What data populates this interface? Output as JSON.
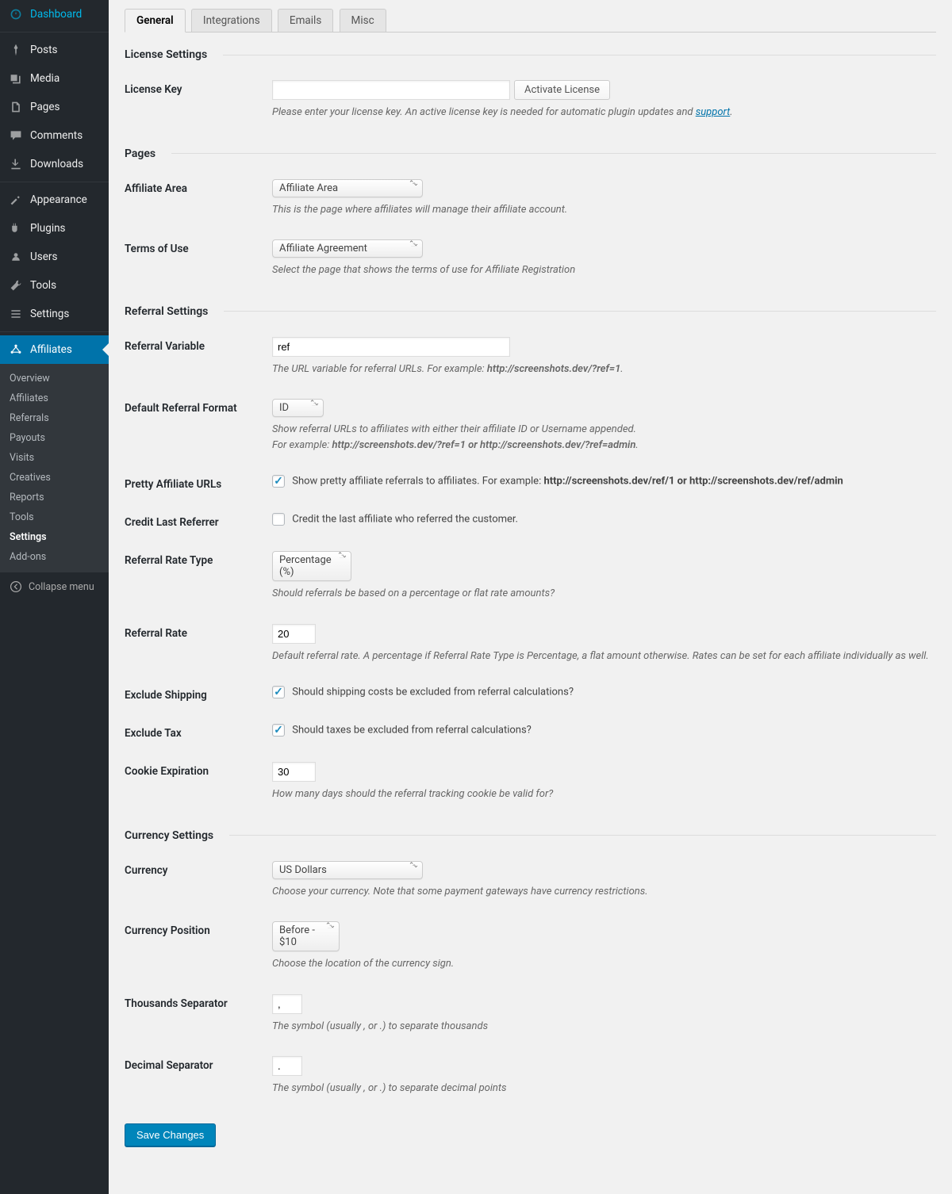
{
  "sidebar": {
    "items": [
      {
        "label": "Dashboard",
        "icon": "dashboard"
      },
      {
        "label": "Posts",
        "icon": "pin"
      },
      {
        "label": "Media",
        "icon": "media"
      },
      {
        "label": "Pages",
        "icon": "pages"
      },
      {
        "label": "Comments",
        "icon": "comments"
      },
      {
        "label": "Downloads",
        "icon": "downloads"
      },
      {
        "label": "Appearance",
        "icon": "appearance"
      },
      {
        "label": "Plugins",
        "icon": "plugins"
      },
      {
        "label": "Users",
        "icon": "users"
      },
      {
        "label": "Tools",
        "icon": "tools"
      },
      {
        "label": "Settings",
        "icon": "settings"
      },
      {
        "label": "Affiliates",
        "icon": "affiliates",
        "active": true
      }
    ],
    "submenu": [
      "Overview",
      "Affiliates",
      "Referrals",
      "Payouts",
      "Visits",
      "Creatives",
      "Reports",
      "Tools",
      "Settings",
      "Add-ons"
    ],
    "submenu_current": "Settings",
    "collapse": "Collapse menu"
  },
  "tabs": [
    "General",
    "Integrations",
    "Emails",
    "Misc"
  ],
  "active_tab": "General",
  "sections": {
    "license": {
      "heading": "License Settings",
      "key_label": "License Key",
      "activate_btn": "Activate License",
      "desc_pre": "Please enter your license key. An active license key is needed for automatic plugin updates and ",
      "desc_link": "support",
      "desc_post": "."
    },
    "pages": {
      "heading": "Pages",
      "affiliate_area_label": "Affiliate Area",
      "affiliate_area_value": "Affiliate Area",
      "affiliate_area_desc": "This is the page where affiliates will manage their affiliate account.",
      "tos_label": "Terms of Use",
      "tos_value": "Affiliate Agreement",
      "tos_desc": "Select the page that shows the terms of use for Affiliate Registration"
    },
    "referral": {
      "heading": "Referral Settings",
      "var_label": "Referral Variable",
      "var_value": "ref",
      "var_desc_pre": "The URL variable for referral URLs. For example: ",
      "var_desc_bold": "http://screenshots.dev/?ref=1",
      "format_label": "Default Referral Format",
      "format_value": "ID",
      "format_desc1": "Show referral URLs to affiliates with either their affiliate ID or Username appended.",
      "format_desc2_pre": "For example: ",
      "format_desc2_bold": "http://screenshots.dev/?ref=1 or http://screenshots.dev/?ref=admin",
      "pretty_label": "Pretty Affiliate URLs",
      "pretty_chk_pre": "Show pretty affiliate referrals to affiliates. For example: ",
      "pretty_chk_bold": "http://screenshots.dev/ref/1 or http://screenshots.dev/ref/admin",
      "credit_label": "Credit Last Referrer",
      "credit_chk": "Credit the last affiliate who referred the customer.",
      "rate_type_label": "Referral Rate Type",
      "rate_type_value": "Percentage (%)",
      "rate_type_desc": "Should referrals be based on a percentage or flat rate amounts?",
      "rate_label": "Referral Rate",
      "rate_value": "20",
      "rate_desc": "Default referral rate. A percentage if Referral Rate Type is Percentage, a flat amount otherwise. Rates can be set for each affiliate individually as well.",
      "excl_ship_label": "Exclude Shipping",
      "excl_ship_chk": "Should shipping costs be excluded from referral calculations?",
      "excl_tax_label": "Exclude Tax",
      "excl_tax_chk": "Should taxes be excluded from referral calculations?",
      "cookie_label": "Cookie Expiration",
      "cookie_value": "30",
      "cookie_desc": "How many days should the referral tracking cookie be valid for?"
    },
    "currency": {
      "heading": "Currency Settings",
      "currency_label": "Currency",
      "currency_value": "US Dollars",
      "currency_desc": "Choose your currency. Note that some payment gateways have currency restrictions.",
      "pos_label": "Currency Position",
      "pos_value": "Before - $10",
      "pos_desc": "Choose the location of the currency sign.",
      "thou_label": "Thousands Separator",
      "thou_value": ",",
      "thou_desc": "The symbol (usually , or .) to separate thousands",
      "dec_label": "Decimal Separator",
      "dec_value": ".",
      "dec_desc": "The symbol (usually , or .) to separate decimal points"
    }
  },
  "save_btn": "Save Changes"
}
